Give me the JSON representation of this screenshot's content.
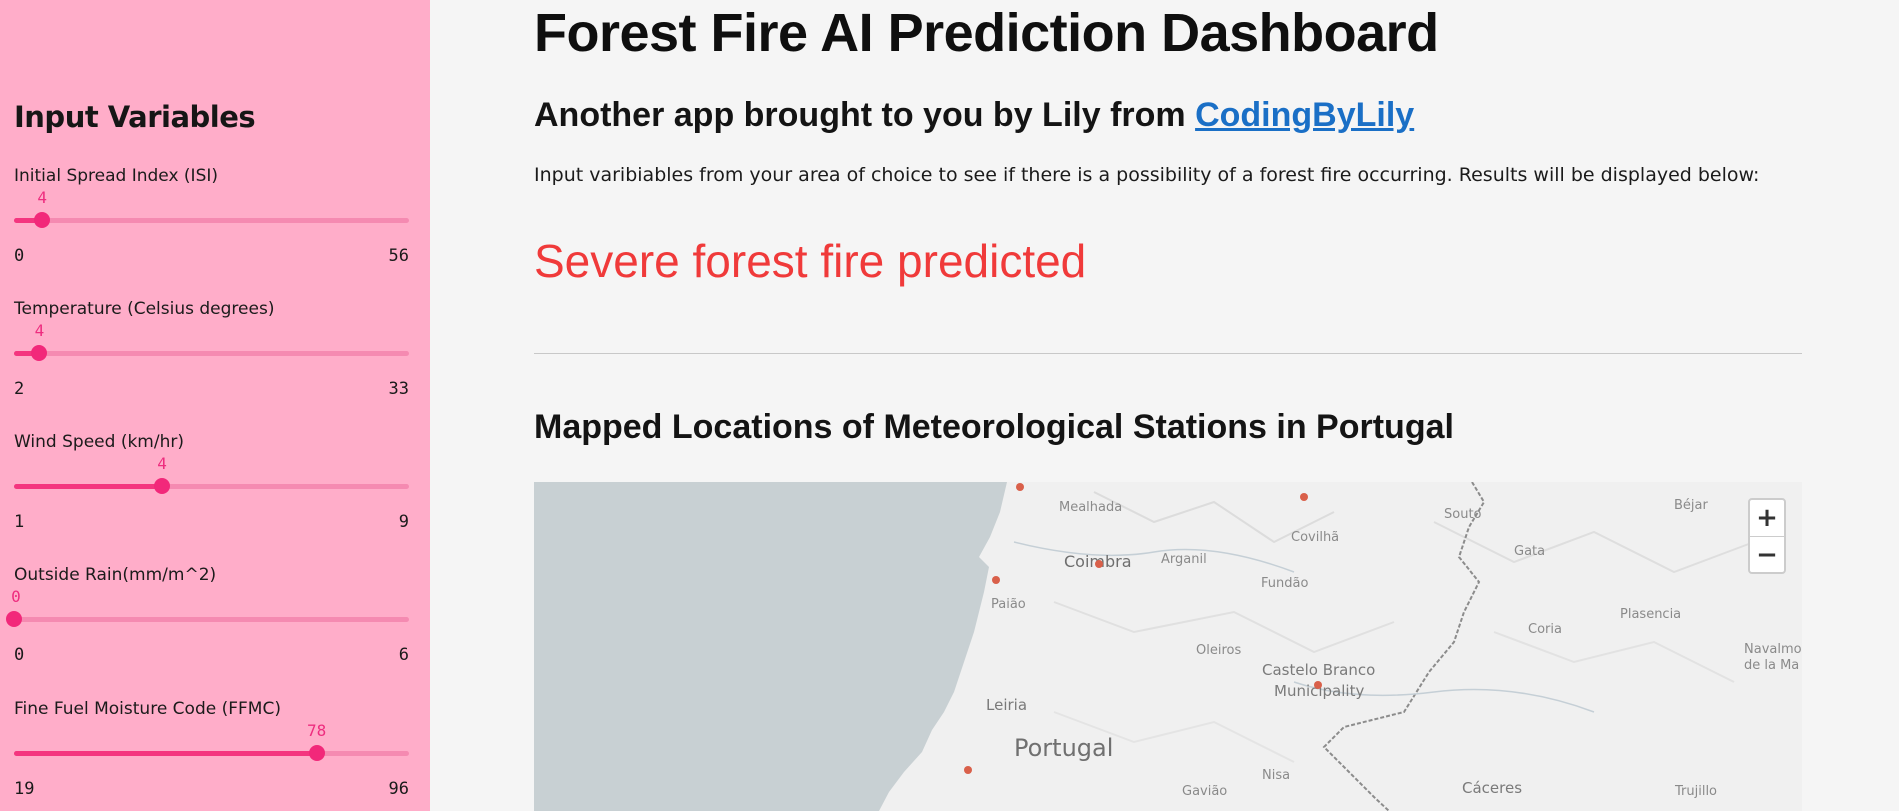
{
  "sidebar": {
    "title": "Input Variables",
    "sliders": [
      {
        "label": "Initial Spread Index (ISI)",
        "value": 4,
        "min": 0,
        "max": 56,
        "value_label": "4",
        "min_label": "0",
        "max_label": "56"
      },
      {
        "label": "Temperature (Celsius degrees)",
        "value": 4,
        "min": 2,
        "max": 33,
        "value_label": "4",
        "min_label": "2",
        "max_label": "33"
      },
      {
        "label": "Wind Speed (km/hr)",
        "value": 4,
        "min": 1,
        "max": 9,
        "value_label": "4",
        "min_label": "1",
        "max_label": "9"
      },
      {
        "label": "Outside Rain(mm/m^2)",
        "value": 0,
        "min": 0,
        "max": 6,
        "value_label": "0",
        "min_label": "0",
        "max_label": "6"
      },
      {
        "label": "Fine Fuel Moisture Code (FFMC)",
        "value": 78,
        "min": 19,
        "max": 96,
        "value_label": "78",
        "min_label": "19",
        "max_label": "96"
      }
    ]
  },
  "main": {
    "title": "Forest Fire AI Prediction Dashboard",
    "subtitle_prefix": "Another app brought to you by Lily from ",
    "subtitle_link": "CodingByLily",
    "intro": "Input varibiables from your area of choice to see if there is a possibility of a forest fire occurring. Results will be displayed below:",
    "prediction": "Severe forest fire predicted",
    "map_heading": "Mapped Locations of Meteorological Stations in Portugal"
  },
  "map": {
    "zoom_in": "+",
    "zoom_out": "−",
    "labels": [
      "Mealhada",
      "Coimbra",
      "Arganil",
      "Covilhã",
      "Souto",
      "Béjar",
      "Gata",
      "Paião",
      "Fundão",
      "Oleiros",
      "Castelo Branco",
      "Municipality",
      "Coria",
      "Plasencia",
      "Navalmor",
      "de la Ma",
      "Leiria",
      "Portugal",
      "Nisa",
      "Gavião",
      "Cáceres",
      "Trujillo"
    ]
  },
  "colors": {
    "sidebar_bg": "#ffadc9",
    "accent": "#f2287a",
    "prediction": "#f03a3a",
    "link": "#1a6fc6"
  }
}
